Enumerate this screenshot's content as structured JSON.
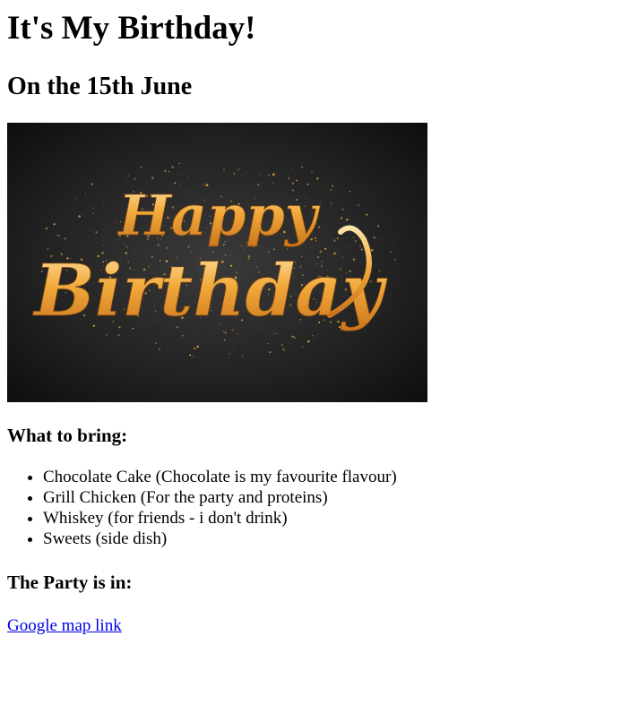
{
  "page": {
    "title": "It's My Birthday!",
    "subtitle": "On the 15th June"
  },
  "banner": {
    "text_line1": "Happy",
    "text_line2": "Birthday",
    "background_color": "#1c1c1c",
    "text_color": "#f2a93b",
    "glitter_color": "#d9a441"
  },
  "bring": {
    "heading": "What to bring:",
    "items": [
      "Chocolate Cake (Chocolate is my favourite flavour)",
      "Grill Chicken (For the party and proteins)",
      "Whiskey (for friends - i don't drink)",
      "Sweets (side dish)"
    ]
  },
  "party": {
    "heading": "The Party is in:",
    "link_text": "Google map link"
  }
}
